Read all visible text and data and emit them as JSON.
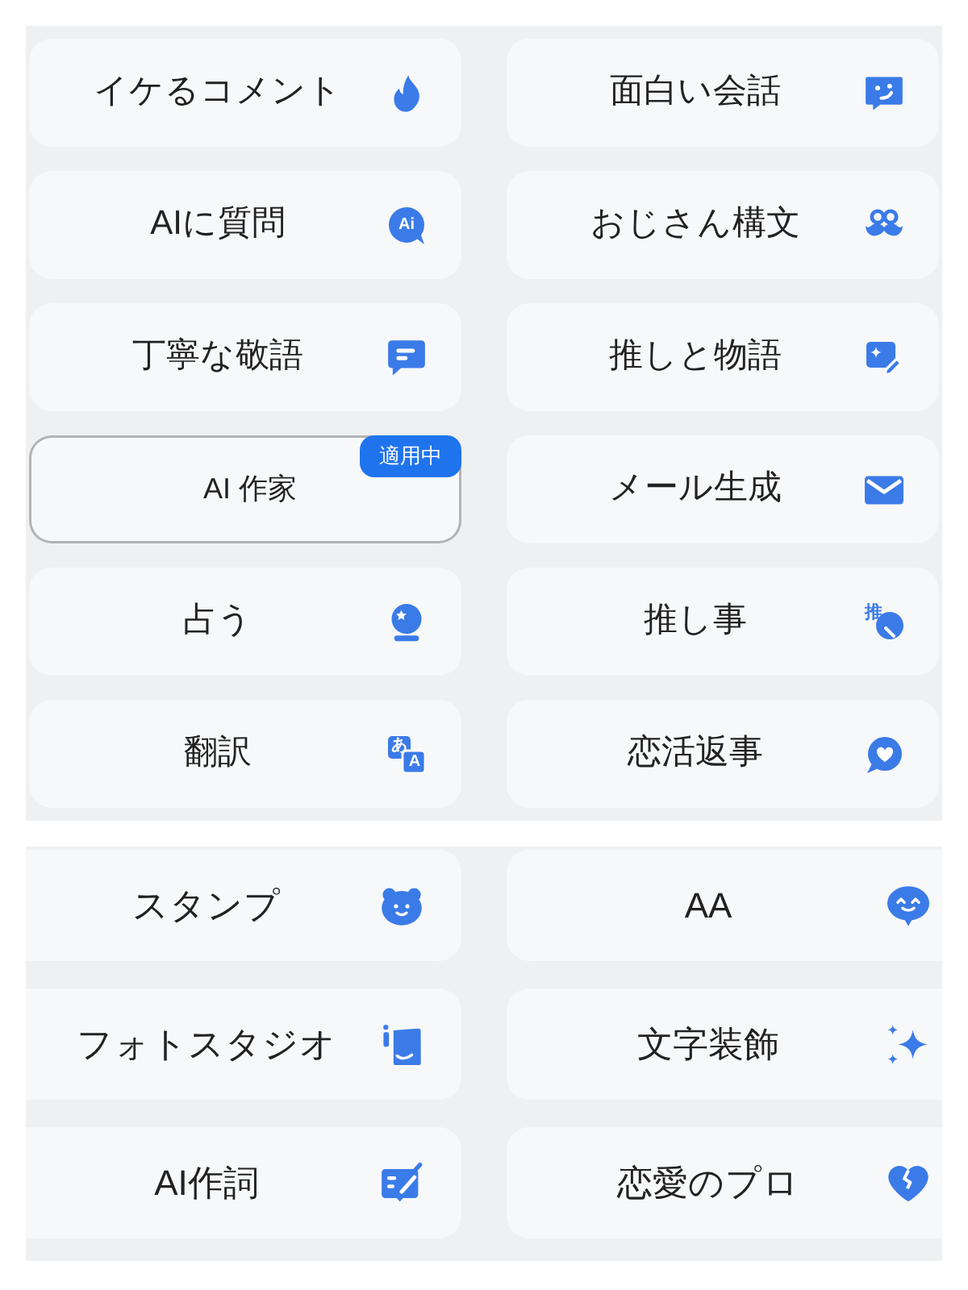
{
  "panels": [
    {
      "items": [
        {
          "label": "イケるコメント",
          "selected": false
        },
        {
          "label": "面白い会話",
          "selected": false
        },
        {
          "label": "AIに質問",
          "selected": false,
          "icon_texts": [
            "Ai"
          ]
        },
        {
          "label": "おじさん構文",
          "selected": false
        },
        {
          "label": "丁寧な敬語",
          "selected": false
        },
        {
          "label": "推しと物語",
          "selected": false
        },
        {
          "label": "AI 作家",
          "selected": true,
          "badge": "適用中"
        },
        {
          "label": "メール生成",
          "selected": false
        },
        {
          "label": "占う",
          "selected": false
        },
        {
          "label": "推し事",
          "selected": false,
          "icon_texts": [
            "推"
          ]
        },
        {
          "label": "翻訳",
          "selected": false,
          "icon_texts": [
            "あ",
            "A"
          ]
        },
        {
          "label": "恋活返事",
          "selected": false
        }
      ]
    },
    {
      "items": [
        {
          "label": "スタンプ",
          "selected": false
        },
        {
          "label": "AA",
          "selected": false
        },
        {
          "label": "フォトスタジオ",
          "selected": false
        },
        {
          "label": "文字装飾",
          "selected": false
        },
        {
          "label": "AI作詞",
          "selected": false
        },
        {
          "label": "恋愛のプロ",
          "selected": false
        }
      ]
    }
  ]
}
